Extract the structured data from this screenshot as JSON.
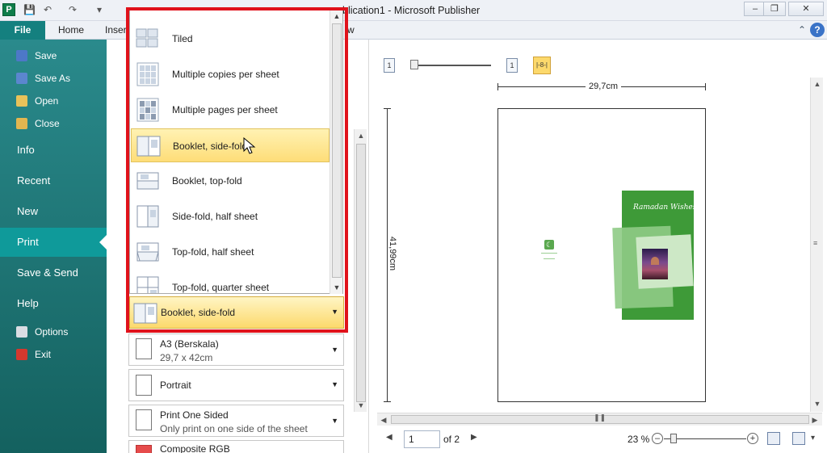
{
  "window": {
    "title": "Publication1 - Microsoft Publisher",
    "title_visible": "blication1 - Microsoft Publisher",
    "app_icon": "P"
  },
  "ribbon": {
    "tabs": [
      "File",
      "Home",
      "Inser",
      "w"
    ]
  },
  "backstage": {
    "commands": [
      {
        "label": "Save",
        "icon": "save-icon"
      },
      {
        "label": "Save As",
        "icon": "save-as-icon"
      },
      {
        "label": "Open",
        "icon": "open-folder-icon"
      },
      {
        "label": "Close",
        "icon": "close-folder-icon"
      }
    ],
    "tabs": [
      "Info",
      "Recent",
      "New",
      "Print",
      "Save & Send",
      "Help"
    ],
    "active_tab": "Print",
    "footer": [
      {
        "label": "Options",
        "icon": "options-icon"
      },
      {
        "label": "Exit",
        "icon": "exit-icon"
      }
    ]
  },
  "page_layout_dropdown": {
    "items": [
      "Tiled",
      "Multiple copies per sheet",
      "Multiple pages per sheet",
      "Booklet, side-fold",
      "Booklet, top-fold",
      "Side-fold, half sheet",
      "Top-fold, half sheet",
      "Top-fold, quarter sheet"
    ],
    "selected": "Booklet, side-fold",
    "combo_value": "Booklet, side-fold"
  },
  "settings": {
    "paper": {
      "main": "A3 (Berskala)",
      "sub": "29,7 x 42cm"
    },
    "orientation": {
      "main": "Portrait"
    },
    "sides": {
      "main": "Print One Sided",
      "sub": "Only print on one side of the sheet"
    },
    "color": {
      "main": "Composite RGB"
    }
  },
  "preview": {
    "width_label": "29,7cm",
    "height_label": "41,99cm",
    "page_title_text": "Ramadan Wishes",
    "page_number": "1",
    "page_total": "of 2",
    "zoom": "23 %",
    "top_icons": [
      "1",
      "1",
      "|-8-|"
    ]
  },
  "colors": {
    "file_tab": "#14807f",
    "backstage": "#1d7b7d",
    "selection": "#fcd96c",
    "highlight": "#e0121b",
    "green_panel": "#3e9a38"
  }
}
